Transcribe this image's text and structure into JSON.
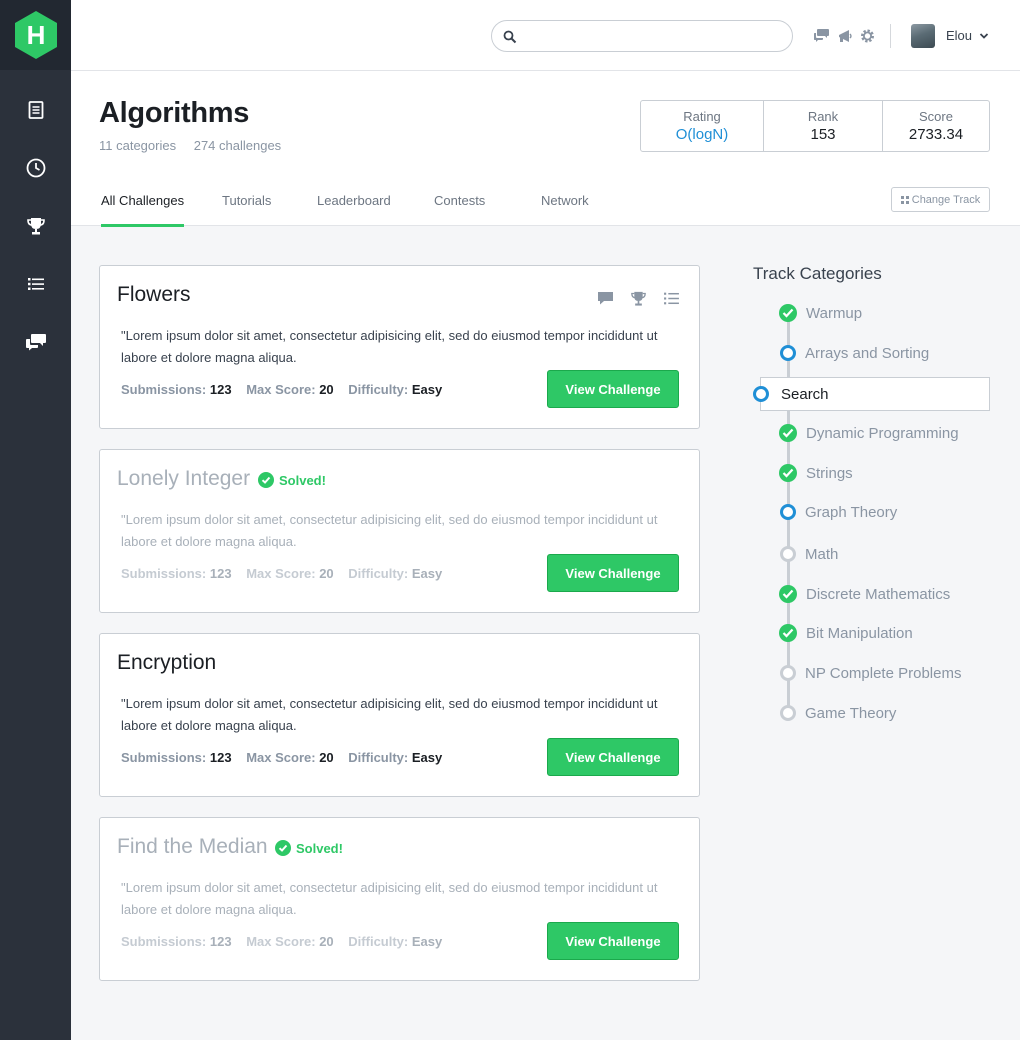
{
  "app": {
    "logo_letter": "H"
  },
  "search": {
    "placeholder": "",
    "value": ""
  },
  "user": {
    "name": "Elou"
  },
  "page": {
    "title": "Algorithms",
    "categories": "11 categories",
    "challenges": "274 challenges"
  },
  "stats": [
    {
      "label": "Rating",
      "value": "O(logN)"
    },
    {
      "label": "Rank",
      "value": "153"
    },
    {
      "label": "Score",
      "value": "2733.34"
    }
  ],
  "tabs": [
    "All Challenges",
    "Tutorials",
    "Leaderboard",
    "Contests",
    "Network"
  ],
  "change_track": "Change Track",
  "card_labels": {
    "submissions": "Submissions:",
    "max_score": "Max Score:",
    "difficulty": "Difficulty:",
    "button": "View Challenge",
    "solved": "Solved!"
  },
  "challenges": [
    {
      "title": "Flowers",
      "solved": false,
      "description": "\"Lorem ipsum dolor sit amet, consectetur adipisicing elit, sed do eiusmod tempor incididunt ut labore et dolore magna aliqua.",
      "submissions": "123",
      "max_score": "20",
      "difficulty": "Easy"
    },
    {
      "title": "Lonely Integer",
      "solved": true,
      "description": "\"Lorem ipsum dolor sit amet, consectetur adipisicing elit, sed do eiusmod tempor incididunt ut labore et dolore magna aliqua.",
      "submissions": "123",
      "max_score": "20",
      "difficulty": "Easy"
    },
    {
      "title": "Encryption",
      "solved": false,
      "description": "\"Lorem ipsum dolor sit amet, consectetur adipisicing elit, sed do eiusmod tempor incididunt ut labore et dolore magna aliqua.",
      "submissions": "123",
      "max_score": "20",
      "difficulty": "Easy"
    },
    {
      "title": "Find the Median",
      "solved": true,
      "description": "\"Lorem ipsum dolor sit amet, consectetur adipisicing elit, sed do eiusmod tempor incididunt ut labore et dolore magna aliqua.",
      "submissions": "123",
      "max_score": "20",
      "difficulty": "Easy"
    }
  ],
  "track": {
    "title": "Track Categories",
    "items": [
      {
        "label": "Warmup",
        "status": "done"
      },
      {
        "label": "Arrays and Sorting",
        "status": "progress"
      },
      {
        "label": "Search",
        "status": "progress",
        "selected": true
      },
      {
        "label": "Dynamic Programming",
        "status": "done"
      },
      {
        "label": "Strings",
        "status": "done"
      },
      {
        "label": "Graph Theory",
        "status": "progress"
      },
      {
        "label": "Math",
        "status": "todo"
      },
      {
        "label": "Discrete Mathematics",
        "status": "done"
      },
      {
        "label": "Bit Manipulation",
        "status": "done"
      },
      {
        "label": "NP Complete Problems",
        "status": "todo"
      },
      {
        "label": "Game Theory",
        "status": "todo"
      }
    ]
  },
  "colors": {
    "accent": "#2ec866",
    "blue": "#1f8fd6",
    "sidebar": "#2b313b"
  }
}
